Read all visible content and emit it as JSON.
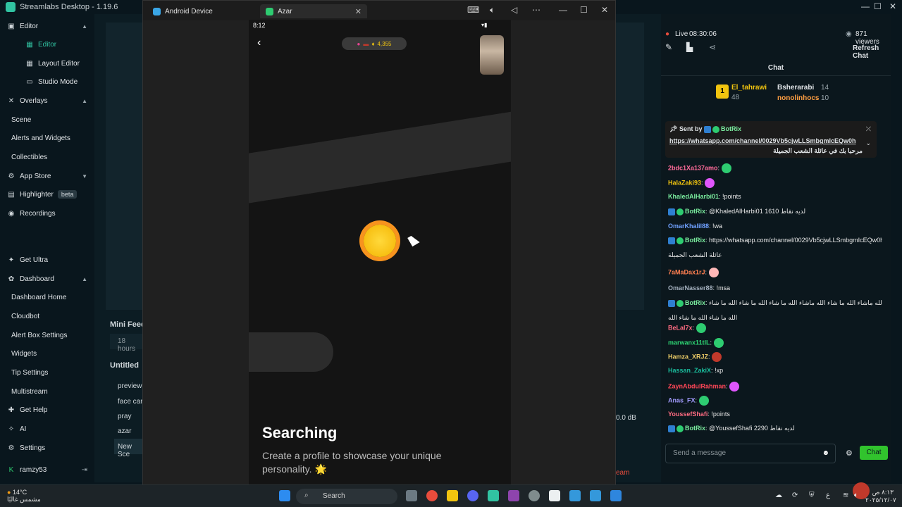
{
  "app": {
    "title": "Streamlabs Desktop - 1.19.6"
  },
  "sidebar": {
    "editor_section": "Editor",
    "editor_items": [
      "Editor",
      "Layout Editor",
      "Studio Mode"
    ],
    "overlays_section": "Overlays",
    "overlays_items": [
      "Scene",
      "Alerts and Widgets",
      "Collectibles"
    ],
    "app_store": "App Store",
    "highlighter": "Highlighter",
    "beta": "beta",
    "recordings": "Recordings",
    "get_ultra": "Get Ultra",
    "dashboard_section": "Dashboard",
    "dashboard_items": [
      "Dashboard Home",
      "Cloudbot",
      "Alert Box Settings",
      "Widgets",
      "Tip Settings",
      "Multistream"
    ],
    "get_help": "Get Help",
    "ai": "AI",
    "settings": "Settings",
    "user": "ramzy53"
  },
  "android": {
    "tab1": "Android Device",
    "tab2": "Azar",
    "time": "8:12",
    "coins": "4,355",
    "title": "Searching",
    "subtitle": "Create a profile to showcase your unique personality. 🌟"
  },
  "studio": {
    "mini_feed": "Mini Feed",
    "hours": "18 hours",
    "untitled": "Untitled",
    "sources": [
      "preview",
      "face can",
      "pray",
      "azar",
      "New Sce"
    ],
    "db": "0.0 dB",
    "team": "eam"
  },
  "chat": {
    "live": "Live",
    "live_time": "08:30:06",
    "viewers": "871 viewers",
    "refresh": "Refresh Chat",
    "header": "Chat",
    "leader1": "El_tahrawi",
    "leader1_count": "48",
    "leader2": "Bsherarabi",
    "leader2_count": "14",
    "leader3": "nonolinhocs",
    "leader3_count": "10",
    "pinned_by": "Sent by",
    "pinned_user": "BotRix",
    "pinned_link": "https://whatsapp.com/channel/0029Vb5cjwLLSmbgmIcEQw0h",
    "pinned_text": "مرحبا بك في عائلة الشعب الجميلة",
    "send_placeholder": "Send a message",
    "send_button": "Chat",
    "messages": [
      {
        "user": "2bdc1Xa137amo",
        "text": "",
        "color": "#ff6b9a"
      },
      {
        "user": "HalaZaki93",
        "text": "",
        "color": "#f1c40f"
      },
      {
        "user": "KhaledAlHarbi01",
        "text": "!points",
        "color": "#7bed9f"
      },
      {
        "user": "BotRix",
        "text": "@KhaledAlHarbi01 1610 لديه نقاط",
        "color": "#7bed9f"
      },
      {
        "user": "OmarKhalil88",
        "text": "!wa",
        "color": "#70a1ff"
      },
      {
        "user": "BotRix",
        "text": "https://whatsapp.com/channel/0029Vb5cjwLLSmbgmIcEQw0h مرحبا بك في",
        "color": "#7bed9f"
      },
      {
        "user": "",
        "text": "عائلة الشعب الجميلة",
        "color": "#e8e8e8"
      },
      {
        "user": "7aMaDax1rJ",
        "text": "",
        "color": "#ff7f50"
      },
      {
        "user": "OmarNasser88",
        "text": "!msa",
        "color": "#a4b0be"
      },
      {
        "user": "BotRix",
        "text": "ما شاء الله ماشاء الله ما شاء الله ماشاء الله ما شاء الله ما شاء الله ما شاء",
        "color": "#7bed9f"
      },
      {
        "user": "",
        "text": "الله ما شاء الله ما شاء الله",
        "color": "#e8e8e8"
      },
      {
        "user": "BeLal7x",
        "text": "",
        "color": "#ff6b81"
      },
      {
        "user": "marwanx11tIL",
        "text": "",
        "color": "#2ed573"
      },
      {
        "user": "Hamza_XRJZ",
        "text": "",
        "color": "#eccc68"
      },
      {
        "user": "Hassan_ZakiX",
        "text": "!xp",
        "color": "#1abc9c"
      },
      {
        "user": "ZaynAbdulRahman",
        "text": "",
        "color": "#ff4757"
      },
      {
        "user": "Anas_FX",
        "text": "",
        "color": "#a29bfe"
      },
      {
        "user": "YoussefShafi",
        "text": "!points",
        "color": "#ff6b81"
      },
      {
        "user": "BotRix",
        "text": "@YoussefShafi 2290 لديه نقاط",
        "color": "#7bed9f"
      }
    ]
  },
  "taskbar": {
    "temp": "14°C",
    "weather_desc": "مشمس غالبًا",
    "search": "Search",
    "time": "٨:١٣ ص",
    "date": "٢٠٢٥/١٢/٠٧"
  }
}
